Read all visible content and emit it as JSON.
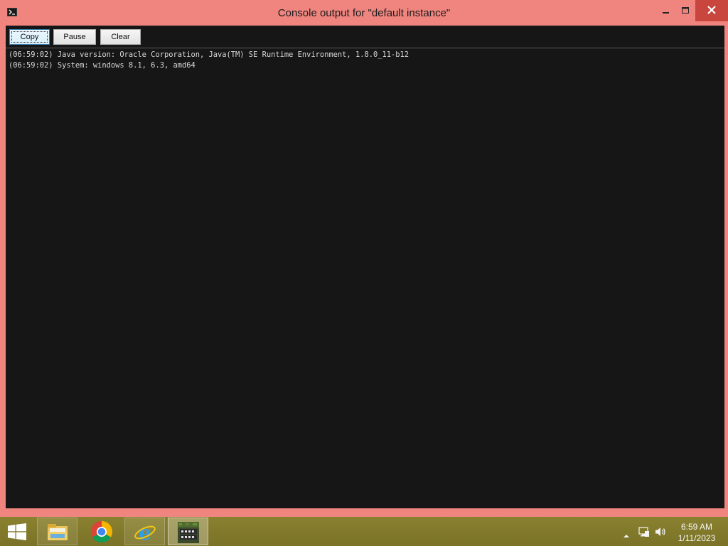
{
  "window": {
    "title": "Console output for \"default instance\"",
    "icons": {
      "app": "console-icon",
      "minimize": "minimize-icon",
      "maximize": "maximize-icon",
      "close": "close-icon"
    }
  },
  "toolbar": {
    "copy_label": "Copy",
    "pause_label": "Pause",
    "clear_label": "Clear"
  },
  "console": {
    "lines": [
      "(06:59:02) Java version: Oracle Corporation, Java(TM) SE Runtime Environment, 1.8.0_11-b12",
      "(06:59:02) System: windows 8.1, 6.3, amd64"
    ]
  },
  "taskbar": {
    "apps": [
      {
        "name": "file-explorer-icon"
      },
      {
        "name": "chrome-icon"
      },
      {
        "name": "internet-explorer-icon"
      },
      {
        "name": "betacraft-icon"
      }
    ],
    "tray": {
      "icons": [
        "show-hidden-icons-arrow",
        "network-icon",
        "volume-icon"
      ],
      "time": "6:59 AM",
      "date": "1/11/2023"
    }
  },
  "colors": {
    "window_frame": "#f0857f",
    "console_background": "#161616",
    "console_text": "#d8d8d8",
    "taskbar": "#8a8130",
    "close_button": "#c8463d"
  }
}
